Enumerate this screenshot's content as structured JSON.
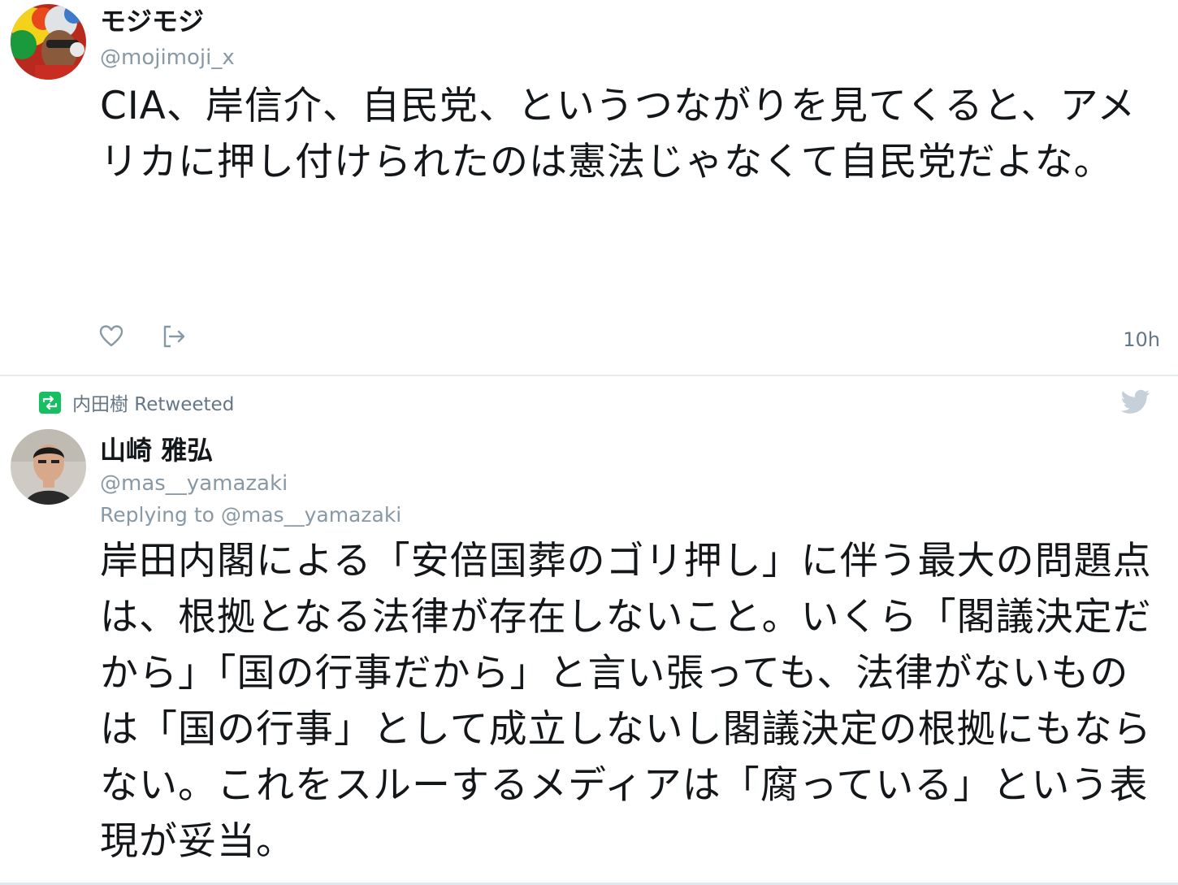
{
  "tweets": [
    {
      "name": "モジモジ",
      "handle": "@mojimoji_x",
      "text": "CIA、岸信介、自民党、というつながりを見てくると、アメリカに押し付けられたのは憲法じゃなくて自民党だよな。",
      "timestamp": "10h",
      "actions": [
        "heart-icon",
        "share-icon"
      ]
    },
    {
      "retweeted_by": "内田樹 Retweeted",
      "name": "山崎 雅弘",
      "handle": "@mas__yamazaki",
      "replying_to": "Replying to @mas__yamazaki",
      "text": "岸田内閣による「安倍国葬のゴリ押し」に伴う最大の問題点は、根拠となる法律が存在しないこと。いくら「閣議決定だから」「国の行事だから」と言い張っても、法律がないものは「国の行事」として成立しないし閣議決定の根拠にもならない。これをスルーするメディアは「腐っている」という表現が妥当。"
    }
  ],
  "colors": {
    "text": "#14171a",
    "secondary": "#8899a6",
    "retweet_green": "#17bf63",
    "divider": "#e6ecf0",
    "bird": "#c5d0da"
  }
}
